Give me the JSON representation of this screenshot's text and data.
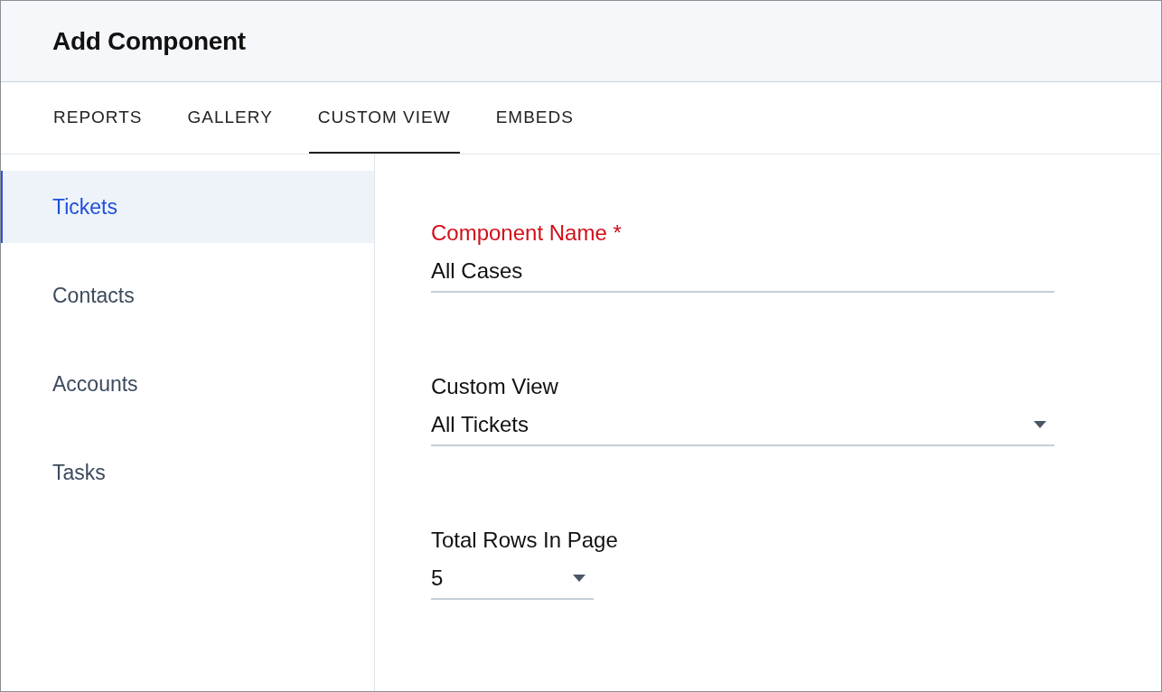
{
  "window": {
    "title": "Add Component"
  },
  "tabs": [
    {
      "label": "REPORTS",
      "selected": false
    },
    {
      "label": "GALLERY",
      "selected": false
    },
    {
      "label": "CUSTOM VIEW",
      "selected": true
    },
    {
      "label": "EMBEDS",
      "selected": false
    }
  ],
  "sidebar": {
    "items": [
      {
        "label": "Tickets",
        "selected": true
      },
      {
        "label": "Contacts",
        "selected": false
      },
      {
        "label": "Accounts",
        "selected": false
      },
      {
        "label": "Tasks",
        "selected": false
      }
    ]
  },
  "form": {
    "fields": [
      {
        "kind": "text",
        "label": "Component Name",
        "required_mark": "*",
        "highlighted": true,
        "value": "All Cases",
        "short": false
      },
      {
        "kind": "select",
        "label": "Custom View",
        "highlighted": false,
        "value": "All Tickets",
        "short": false
      },
      {
        "kind": "select",
        "label": "Total Rows In Page",
        "highlighted": false,
        "value": "5",
        "short": true
      }
    ]
  }
}
